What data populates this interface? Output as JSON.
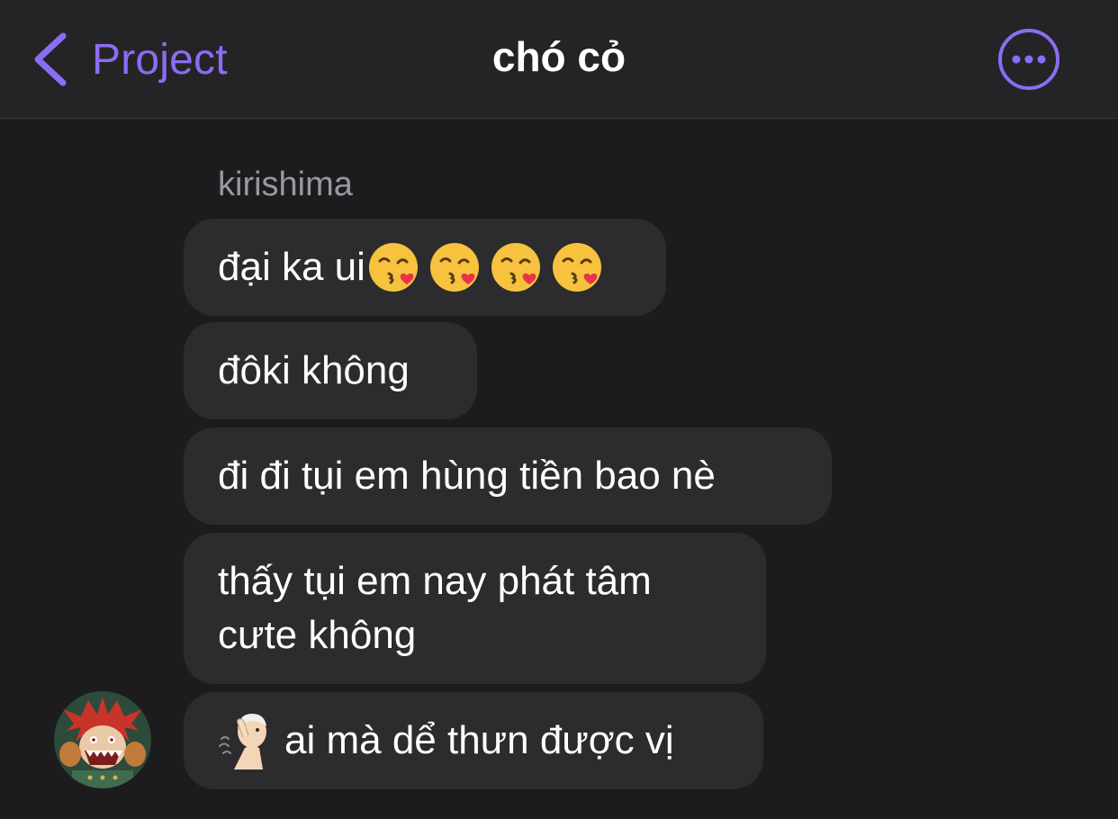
{
  "header": {
    "back_label": "Project",
    "title": "chó cỏ",
    "accent_color": "#8c6cf4",
    "back_icon": "chevron-left-icon",
    "more_icon": "more-options-icon"
  },
  "conversation": {
    "sender": "kirishima",
    "messages": [
      {
        "text": "đại ka ui",
        "emoji": "face-blowing-kiss",
        "emoji_count": 4
      },
      {
        "text": "đôki không"
      },
      {
        "text": "đi đi tụi em hùng tiền bao nè"
      },
      {
        "text": "thấy tụi em nay phát tâm cưte không"
      },
      {
        "text": "ai mà dể thưn được vị",
        "emoji": "deaf-person-gesture"
      }
    ],
    "avatar": "user-avatar"
  }
}
